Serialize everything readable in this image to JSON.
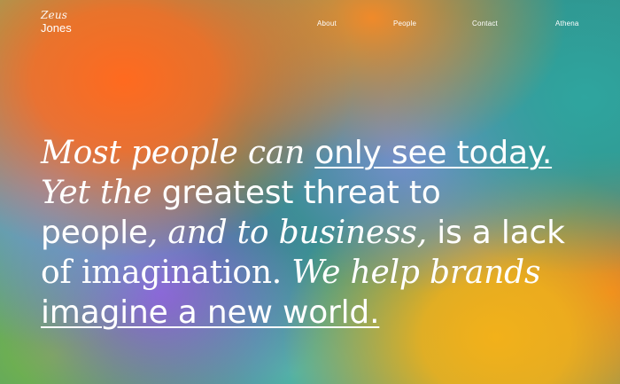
{
  "brand": {
    "line1": "Zeus",
    "line2": "Jones"
  },
  "nav": {
    "items": [
      "About",
      "People",
      "Contact",
      "Athena"
    ]
  },
  "headline": {
    "l1_serif": "Most people can ",
    "l1_link": "only see today.",
    "l2_serif": "Yet the ",
    "l2_sans": "greatest threat to",
    "l3_sans_a": "people",
    "l3_serif": ", and to business, ",
    "l3_sans_b": "is a lack",
    "l4_roman": "of imagination.",
    "l4_serif": " We help brands",
    "l5_link": "imagine a new world."
  },
  "colors": {
    "text": "#ffffff",
    "orange": "#ff6a1f",
    "teal": "#2f8f86",
    "purple": "#8e63d8",
    "yellow": "#f2b11a"
  }
}
